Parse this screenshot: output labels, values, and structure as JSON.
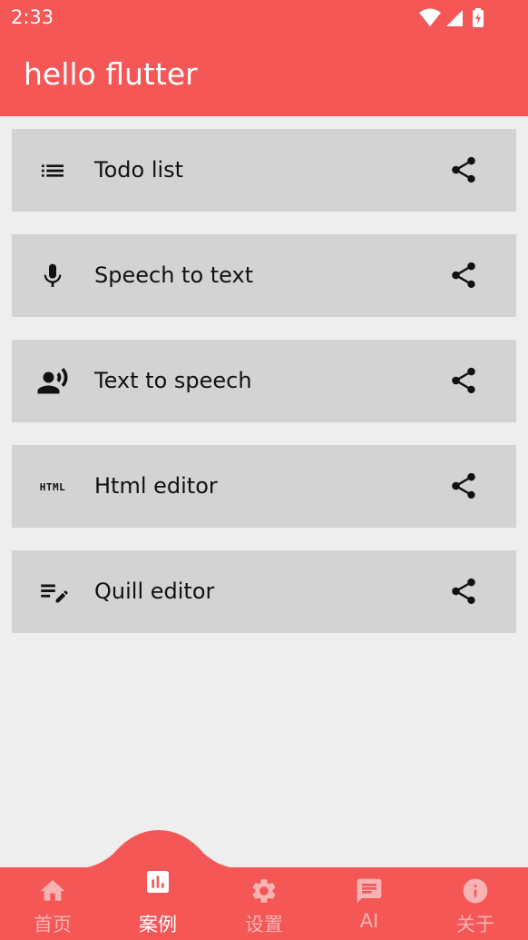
{
  "status_bar": {
    "time": "2:33",
    "icons": [
      "wifi-icon",
      "signal-icon",
      "battery-charging-icon"
    ]
  },
  "app_bar": {
    "title": "hello flutter"
  },
  "items": [
    {
      "label": "Todo list",
      "icon": "list-icon"
    },
    {
      "label": "Speech to text",
      "icon": "mic-icon"
    },
    {
      "label": "Text to speech",
      "icon": "record-voice-icon"
    },
    {
      "label": "Html editor",
      "icon": "html-icon",
      "icon_text": "HTML"
    },
    {
      "label": "Quill editor",
      "icon": "edit-note-icon"
    }
  ],
  "bottom_nav": {
    "items": [
      {
        "label": "首页",
        "icon": "home-icon"
      },
      {
        "label": "案例",
        "icon": "chart-icon",
        "active": true
      },
      {
        "label": "设置",
        "icon": "gear-icon"
      },
      {
        "label": "AI",
        "icon": "chat-icon"
      },
      {
        "label": "关于",
        "icon": "info-icon"
      }
    ]
  },
  "colors": {
    "primary": "#f55656",
    "card": "#d3d3d3",
    "background": "#eeeeee",
    "nav_inactive": "#f7b3b3",
    "nav_active": "#ffffff"
  }
}
